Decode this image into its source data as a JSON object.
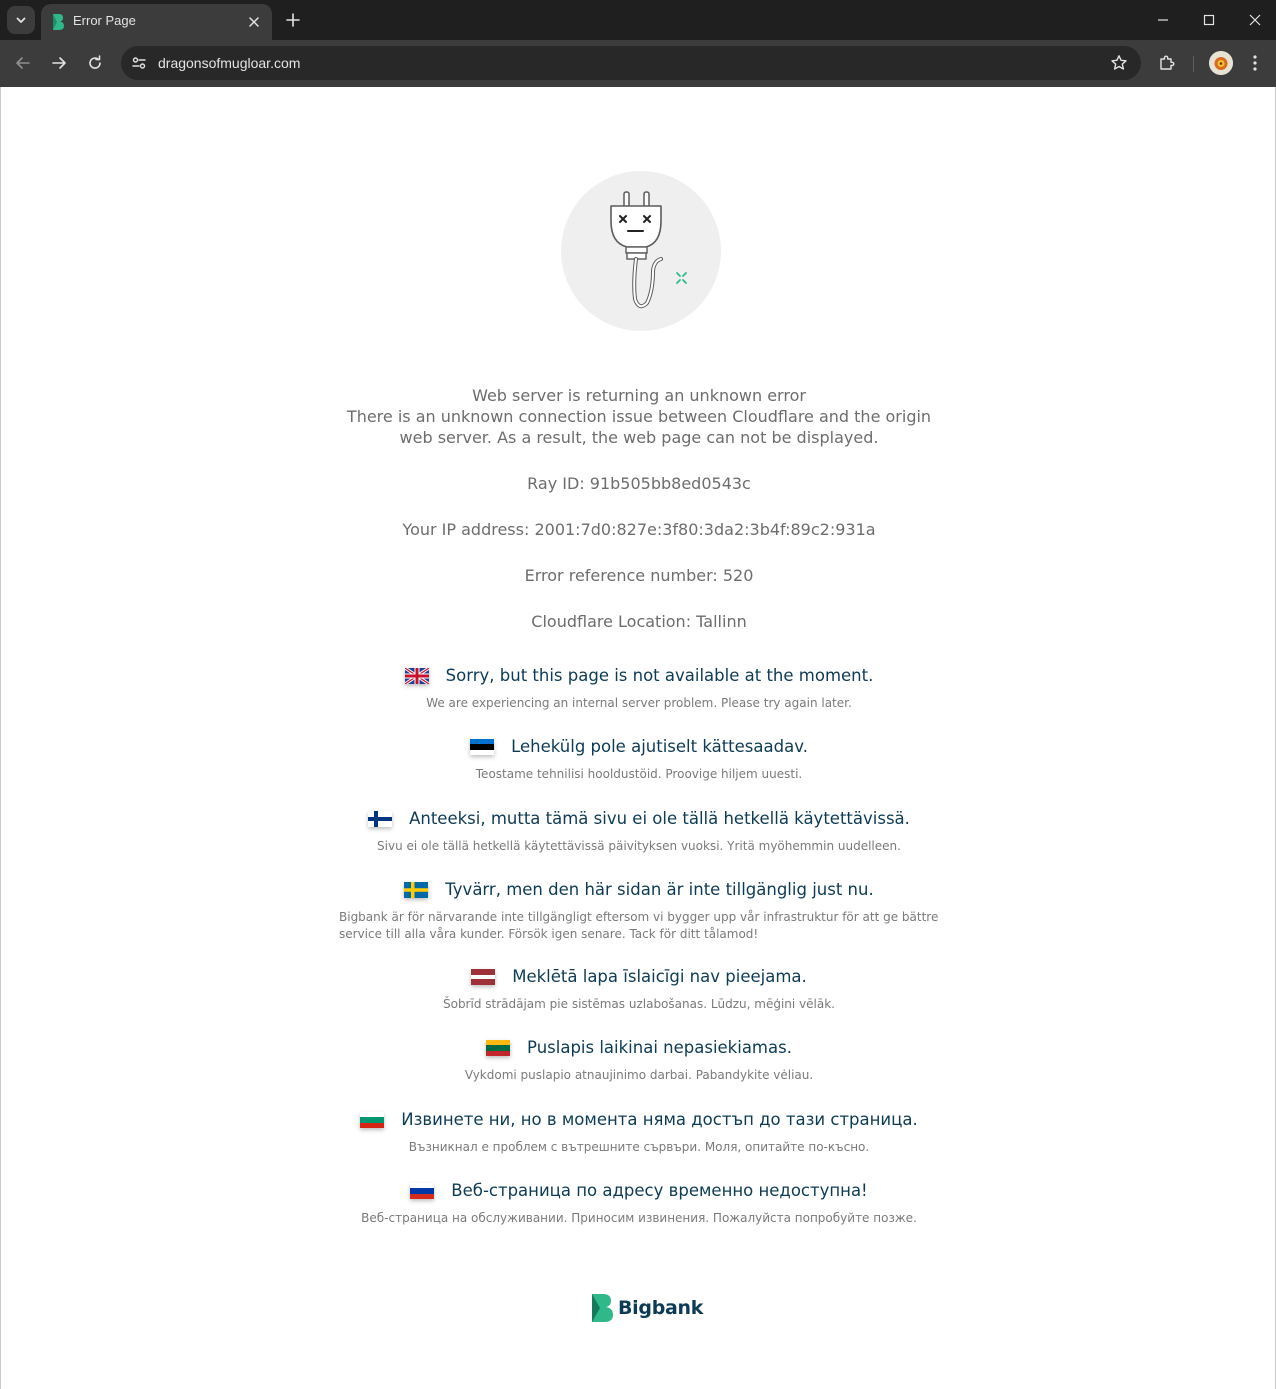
{
  "browser": {
    "tab_title": "Error Page",
    "url": "dragonsofmugloar.com"
  },
  "colors": {
    "chrome_dark": "#1f1f1f",
    "toolbar": "#3c3c3c",
    "heading_text": "#0d3b55",
    "muted_text": "#6d6d6d",
    "accent_green": "#2fb98a"
  },
  "icons": [
    "chevron-down-icon",
    "bigbank-favicon",
    "close-icon",
    "plus-icon",
    "minimize-icon",
    "maximize-icon",
    "window-close-icon",
    "back-arrow-icon",
    "forward-arrow-icon",
    "reload-icon",
    "site-info-icon",
    "star-icon",
    "extensions-icon",
    "profile-avatar",
    "menu-dots-icon",
    "unplugged-plug-icon"
  ],
  "cloudflare": {
    "line1": "Web server is returning an unknown error",
    "line2": "There is an unknown connection issue between Cloudflare and the origin",
    "line3": "web server. As a result, the web page can not be displayed.",
    "ray_id": "Ray ID: 91b505bb8ed0543c",
    "ip": "Your IP address: 2001:7d0:827e:3f80:3da2:3b4f:89c2:931a",
    "error_ref": "Error reference number: 520",
    "location": "Cloudflare Location: Tallinn"
  },
  "messages": [
    {
      "flag": "uk",
      "title": "Sorry, but this page is not available at the moment.",
      "subtitle": "We are experiencing an internal server problem. Please try again later."
    },
    {
      "flag": "ee",
      "title": "Lehekülg pole ajutiselt kättesaadav.",
      "subtitle": "Teostame tehnilisi hooldustöid. Proovige hiljem uuesti."
    },
    {
      "flag": "fi",
      "title": "Anteeksi, mutta tämä sivu ei ole tällä hetkellä käytettävissä.",
      "subtitle": "Sivu ei ole tällä hetkellä käytettävissä päivityksen vuoksi. Yritä myöhemmin uudelleen."
    },
    {
      "flag": "se",
      "title": "Tyvärr, men den här sidan är inte tillgänglig just nu.",
      "subtitle": "Bigbank är för närvarande inte tillgängligt eftersom vi bygger upp vår infrastruktur för att ge bättre service till alla våra kunder. Försök igen senare. Tack för ditt tålamod!"
    },
    {
      "flag": "lv",
      "title": "Meklētā lapa īslaicīgi nav pieejama.",
      "subtitle": "Šobrīd strādājam pie sistēmas uzlabošanas. Lūdzu, mēģini vēlāk."
    },
    {
      "flag": "lt",
      "title": "Puslapis laikinai nepasiekiamas.",
      "subtitle": "Vykdomi puslapio atnaujinimo darbai. Pabandykite vėliau."
    },
    {
      "flag": "bg",
      "title": "Извинете ни, но в момента няма достъп до тази страница.",
      "subtitle": "Възникнал е проблем с вътрешните сървъри. Моля, опитайте по-късно."
    },
    {
      "flag": "ru",
      "title": "Веб-страница по адресу временно недоступна!",
      "subtitle": "Веб-страница на обслуживании. Приносим извинения. Пожалуйста попробуйте позже."
    }
  ],
  "brand": {
    "name": "Bigbank"
  }
}
